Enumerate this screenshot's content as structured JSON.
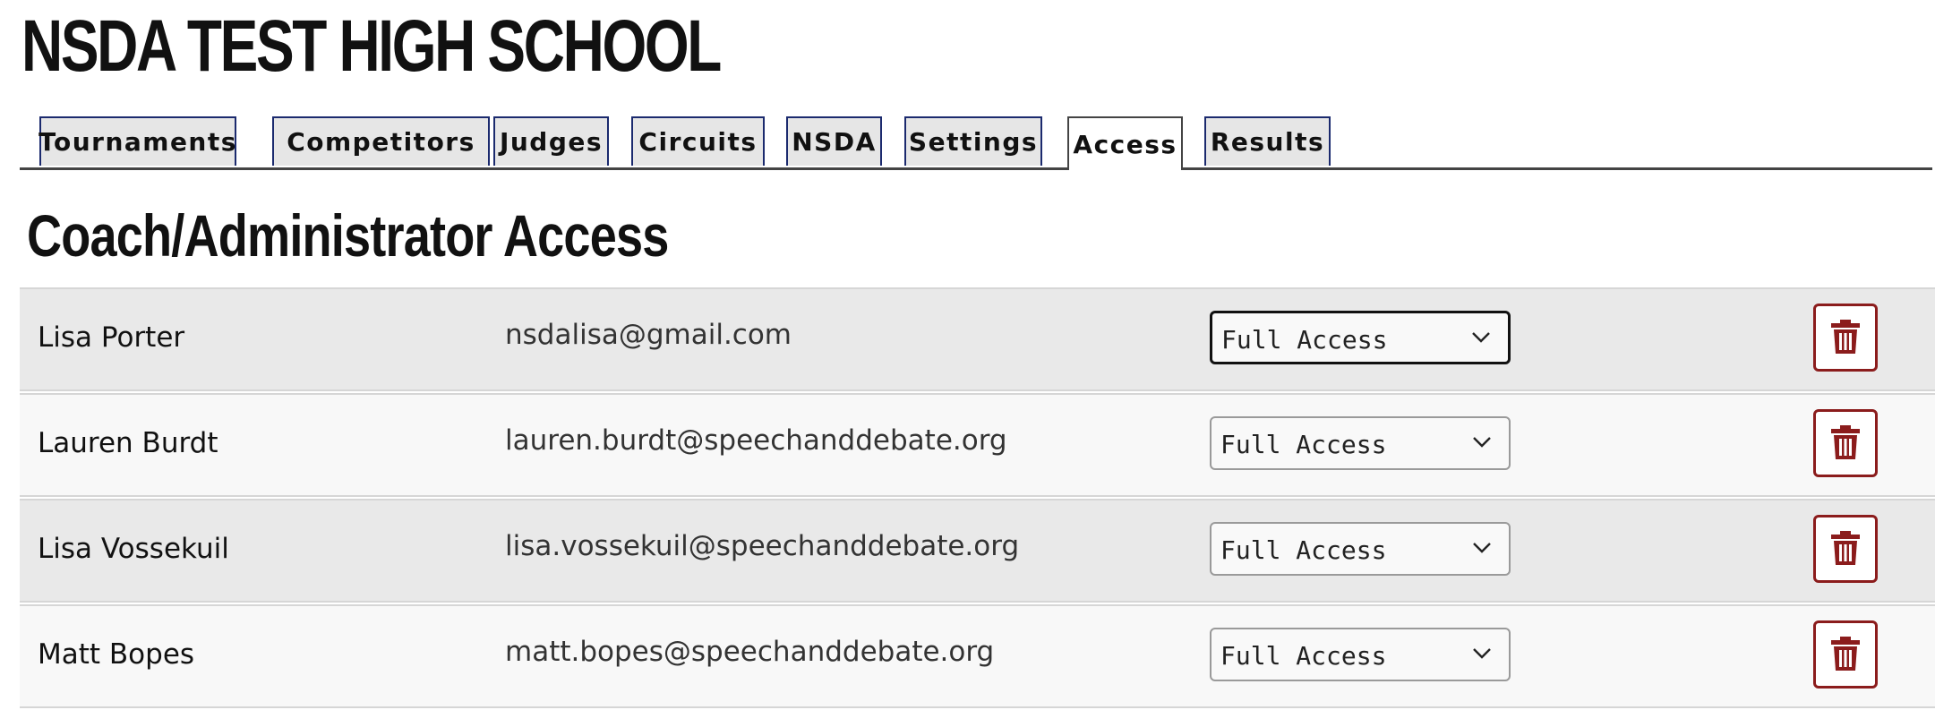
{
  "page": {
    "school_title": "NSDA TEST HIGH SCHOOL",
    "section_title": "Coach/Administrator Access"
  },
  "tabs": [
    {
      "label": "Tournaments",
      "active": false
    },
    {
      "label": "Competitors",
      "active": false
    },
    {
      "label": "Judges",
      "active": false
    },
    {
      "label": "Circuits",
      "active": false
    },
    {
      "label": "NSDA",
      "active": false
    },
    {
      "label": "Settings",
      "active": false
    },
    {
      "label": "Access",
      "active": true
    },
    {
      "label": "Results",
      "active": false
    }
  ],
  "access_rows": [
    {
      "name": "Lisa Porter",
      "email": "nsdalisa@gmail.com",
      "access": "Full Access"
    },
    {
      "name": "Lauren Burdt",
      "email": "lauren.burdt@speechanddebate.org",
      "access": "Full Access"
    },
    {
      "name": "Lisa Vossekuil",
      "email": "lisa.vossekuil@speechanddebate.org",
      "access": "Full Access"
    },
    {
      "name": "Matt Bopes",
      "email": "matt.bopes@speechanddebate.org",
      "access": "Full Access"
    }
  ],
  "icons": {
    "select_arrow": "chevron-down-icon",
    "delete": "trash-icon"
  },
  "colors": {
    "tab_border": "#1b2a6e",
    "delete_accent": "#8b1c1c",
    "row_odd": "#e9e9e9",
    "row_even": "#f8f8f8"
  }
}
